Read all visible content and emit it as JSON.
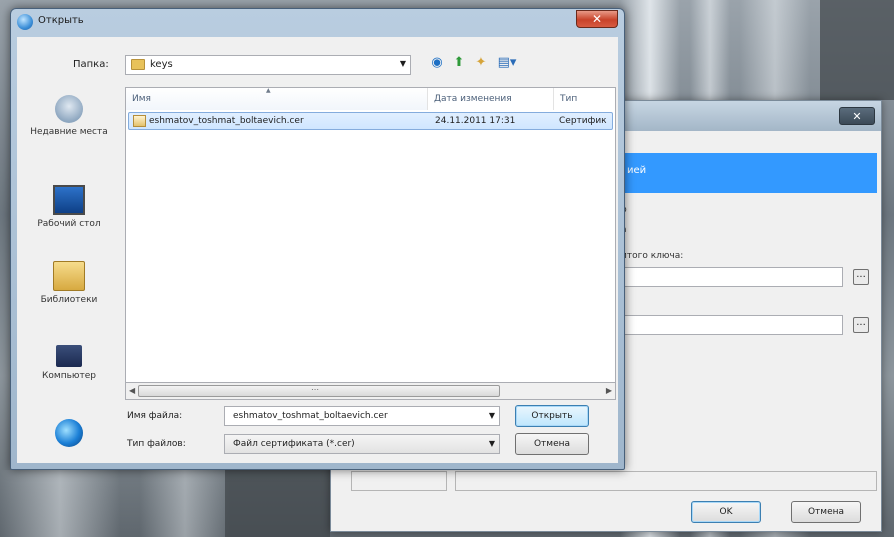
{
  "dialog": {
    "title": "Открыть",
    "close_glyph": "✕",
    "look_in_label": "Папка:",
    "look_in_value": "keys",
    "toolbar": {
      "back_icon": "back-globe-icon",
      "up_icon": "up-folder-icon",
      "new_folder_icon": "new-folder-icon",
      "view_icon": "view-menu-icon"
    },
    "places": [
      {
        "label": "Недавние места",
        "icon": "recent-places-icon"
      },
      {
        "label": "Рабочий стол",
        "icon": "desktop-icon"
      },
      {
        "label": "Библиотеки",
        "icon": "libraries-icon"
      },
      {
        "label": "Компьютер",
        "icon": "computer-icon"
      }
    ],
    "columns": [
      "Имя",
      "Дата изменения",
      "Тип"
    ],
    "files": [
      {
        "name": "eshmatov_toshmat_boltaevich.cer",
        "date": "24.11.2011 17:31",
        "type": "Сертифик"
      }
    ],
    "file_name_label": "Имя файла:",
    "file_name_value": "eshmatov_toshmat_boltaevich.cer",
    "file_type_label": "Тип файлов:",
    "file_type_value": "Файл сертификата (*.cer)",
    "open_button": "Открыть",
    "cancel_button": "Отмена"
  },
  "background_dialog": {
    "close_glyph": "✕",
    "selected_item": "ией",
    "key_label": "итого ключа:",
    "ok_button": "OK",
    "cancel_button": "Отмена"
  }
}
